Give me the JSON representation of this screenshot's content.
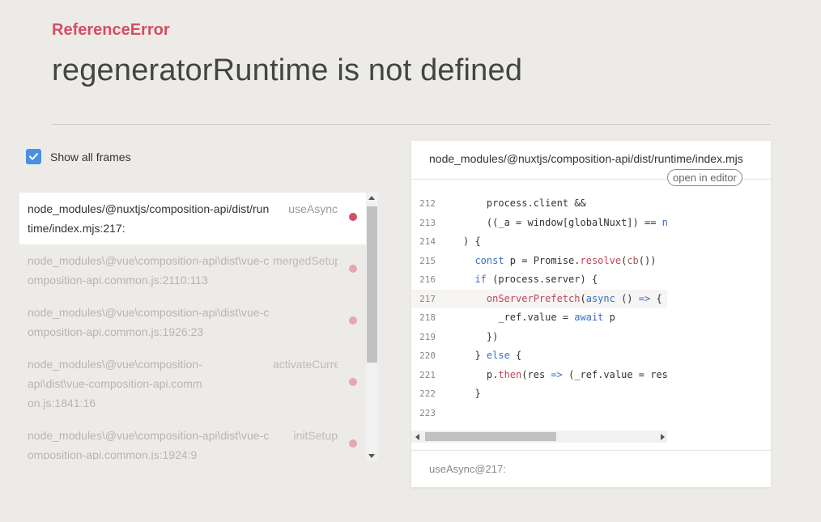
{
  "error": {
    "type": "ReferenceError",
    "message": "regeneratorRuntime is not defined"
  },
  "show_all_frames": {
    "label": "Show all frames",
    "checked": true
  },
  "frames": [
    {
      "file": "node_modules/@nuxtjs/composition-api/dist/runtime/index.mjs:217:",
      "fn": "useAsync",
      "active": true
    },
    {
      "file": "node_modules\\@vue\\composition-api\\dist\\vue-composition-api.common.js:2110:113",
      "fn": "mergedSetupFn",
      "active": false
    },
    {
      "file": "node_modules\\@vue\\composition-api\\dist\\vue-composition-api.common.js:1926:23",
      "fn": "",
      "active": false
    },
    {
      "file": "node_modules\\@vue\\composition-api\\dist\\vue-composition-api.common.js:1841:16",
      "fn": "activateCurrentInstance",
      "active": false
    },
    {
      "file": "node_modules\\@vue\\composition-api\\dist\\vue-composition-api.common.js:1924:9",
      "fn": "initSetup",
      "active": false
    }
  ],
  "code_panel": {
    "path": "node_modules/@nuxtjs/composition-api/dist/runtime/index.mjs",
    "open_in_editor": "open in editor",
    "highlight_line": "217",
    "line_numbers": [
      "212",
      "213",
      "214",
      "215",
      "216",
      "217",
      "218",
      "219",
      "220",
      "221",
      "222",
      "223"
    ],
    "footer": "useAsync@217:"
  },
  "colors": {
    "error_accent": "#d24f63",
    "checkbox": "#4a8fe2",
    "background": "#edebe8"
  }
}
